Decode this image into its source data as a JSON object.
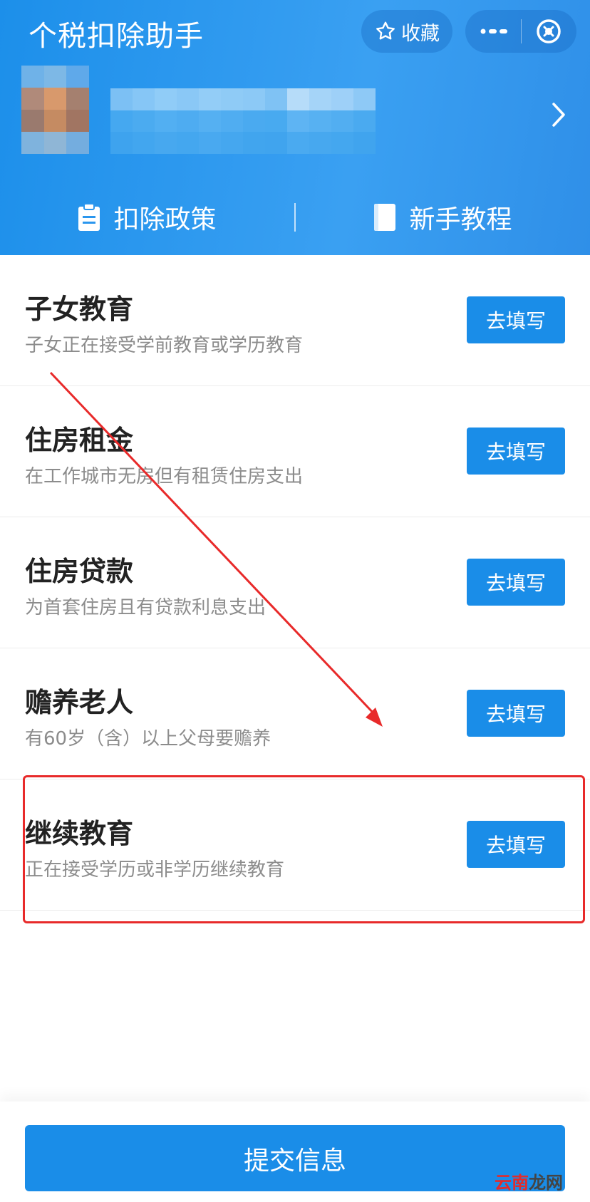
{
  "header": {
    "title": "个税扣除助手",
    "favorite_label": "收藏"
  },
  "quick_links": [
    {
      "label": "扣除政策",
      "icon": "clipboard-icon"
    },
    {
      "label": "新手教程",
      "icon": "book-icon"
    }
  ],
  "items": [
    {
      "title": "子女教育",
      "desc": "子女正在接受学前教育或学历教育",
      "button": "去填写"
    },
    {
      "title": "住房租金",
      "desc": "在工作城市无房但有租赁住房支出",
      "button": "去填写"
    },
    {
      "title": "住房贷款",
      "desc": "为首套住房且有贷款利息支出",
      "button": "去填写"
    },
    {
      "title": "赡养老人",
      "desc": "有60岁（含）以上父母要赡养",
      "button": "去填写"
    },
    {
      "title": "继续教育",
      "desc": "正在接受学历或非学历继续教育",
      "button": "去填写"
    }
  ],
  "submit_label": "提交信息",
  "watermark": {
    "part1": "云南",
    "part2": "龙网"
  },
  "colors": {
    "header_blue": "#2a96ee",
    "button_blue": "#1a8de8",
    "annotation_red": "#e82a2a"
  }
}
